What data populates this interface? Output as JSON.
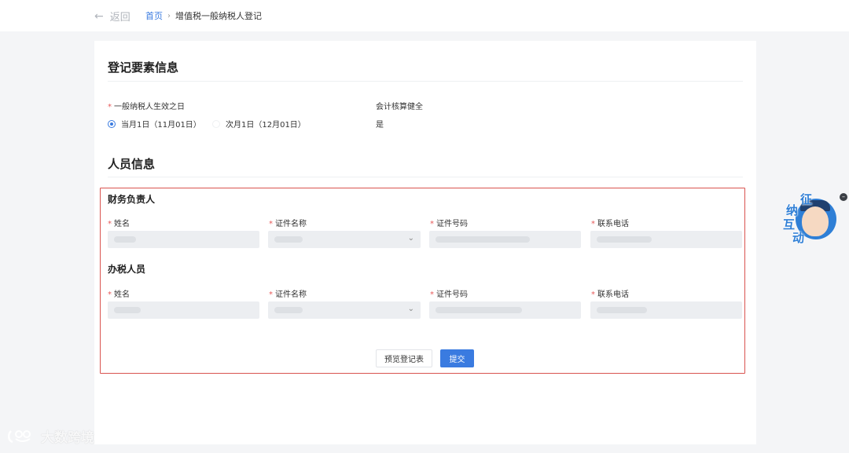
{
  "header": {
    "back_label": "返回",
    "breadcrumb": {
      "home": "首页",
      "current": "增值税一般纳税人登记"
    }
  },
  "registration": {
    "title": "登记要素信息",
    "effective_date": {
      "label": "一般纳税人生效之日",
      "options": [
        {
          "label": "当月1日（11月01日）",
          "selected": true
        },
        {
          "label": "次月1日（12月01日）",
          "selected": false
        }
      ]
    },
    "accounting": {
      "label": "会计核算健全",
      "value": "是"
    }
  },
  "personnel": {
    "title": "人员信息",
    "groups": [
      {
        "title": "财务负责人",
        "fields": [
          {
            "label": "姓名",
            "type": "input"
          },
          {
            "label": "证件名称",
            "type": "select"
          },
          {
            "label": "证件号码",
            "type": "input"
          },
          {
            "label": "联系电话",
            "type": "input"
          }
        ]
      },
      {
        "title": "办税人员",
        "fields": [
          {
            "label": "姓名",
            "type": "input"
          },
          {
            "label": "证件名称",
            "type": "select"
          },
          {
            "label": "证件号码",
            "type": "input"
          },
          {
            "label": "联系电话",
            "type": "input"
          }
        ]
      }
    ]
  },
  "actions": {
    "preview": "预览登记表",
    "submit": "提交"
  },
  "widget": {
    "chars": [
      "征",
      "纳",
      "互",
      "动"
    ]
  },
  "watermark": {
    "text": "大数跨境"
  },
  "colors": {
    "accent": "#3a7be0",
    "required": "#e85a5a",
    "highlight_border": "#d9534f"
  }
}
